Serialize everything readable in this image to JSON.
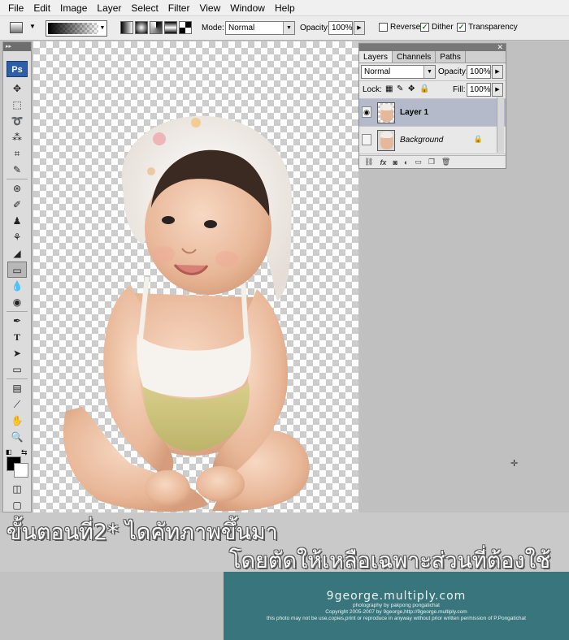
{
  "menu": [
    "File",
    "Edit",
    "Image",
    "Layer",
    "Select",
    "Filter",
    "View",
    "Window",
    "Help"
  ],
  "options_bar": {
    "mode_label": "Mode:",
    "mode_value": "Normal",
    "opacity_label": "Opacity:",
    "opacity_value": "100%",
    "reverse_label": "Reverse",
    "reverse_checked": false,
    "dither_label": "Dither",
    "dither_checked": true,
    "transparency_label": "Transparency",
    "transparency_checked": true
  },
  "toolbox": {
    "logo": "Ps",
    "text_tool": "T"
  },
  "layers_panel": {
    "tabs": [
      "Layers",
      "Channels",
      "Paths"
    ],
    "blend_mode": "Normal",
    "opacity_label": "Opacity:",
    "opacity_value": "100%",
    "lock_label": "Lock:",
    "fill_label": "Fill:",
    "fill_value": "100%",
    "layers": [
      {
        "name": "Layer 1",
        "selected": true,
        "visible": true
      },
      {
        "name": "Background",
        "selected": false,
        "visible": false,
        "locked": true
      }
    ]
  },
  "caption": {
    "line1": "ขั้นตอนที่2* ไดคัทภาพขึ้นมา",
    "line2": "โดยตัดให้เหลือเฉพาะส่วนที่ต้องใช้"
  },
  "watermark": {
    "title": "9george.multiply.com",
    "line1": "photography by pakpong pongatichat",
    "line2": "Copyright 2005-2007 by 9george,http://9george.multiply.com",
    "line3": "this photo may not be use,copies,print or reproduce in anyway without prior written permission of P.Pongatichat"
  },
  "colors": {
    "watermark_bg": "#38757c",
    "selected_layer_bg": "#b4bac9",
    "ps_logo": "#2d5fa8"
  }
}
